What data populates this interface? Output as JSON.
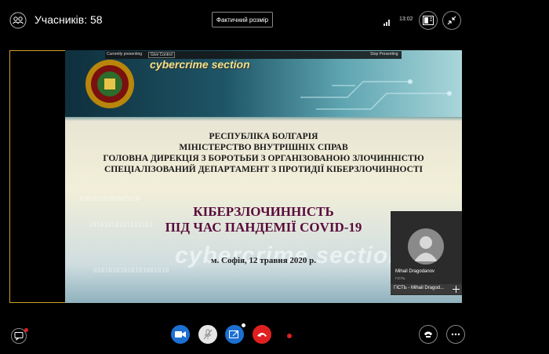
{
  "topbar": {
    "participants_label": "Учасників: 58",
    "actual_size_label": "Фактичний розмір",
    "time": "13:02"
  },
  "present_bar": {
    "currently_presenting": "Currently presenting",
    "give_control": "Give Control",
    "stop_presenting": "Stop Presenting"
  },
  "slide": {
    "logo_text": "cybercrime section",
    "watermark_text": "cybercrime section",
    "org_lines": [
      "РЕСПУБЛІКА БОЛГАРІЯ",
      "МІНІСТЕРСТВО ВНУТРІШНІХ СПРАВ",
      "ГОЛОВНА ДИРЕКЦІЯ З БОРОТЬБИ З ОРГАНІЗОВАНОЮ ЗЛОЧИННІСТЮ",
      "СПЕЦІАЛІЗОВАНИЙ ДЕПАРТАМЕНТ З ПРОТИДІЇ КІБЕРЗЛОЧИННОСТІ"
    ],
    "title_lines": [
      "КІБЕРЗЛОЧИННІСТЬ",
      "ПІД ЧАС ПАНДЕМІЇ COVID-19"
    ],
    "date_line": "м. Софія, 12 травня 2020  р.",
    "binary_lines": [
      "0101010101001010",
      "10101010101010101",
      "01010101010101001010"
    ]
  },
  "video_tile": {
    "name": "Mihail Dragodanov",
    "role": "ГІСТЬ",
    "footer_label": "ГІСТЬ - Mihail Dragod..."
  },
  "icons": {
    "participants": "people-icon",
    "layout": "layout-icon",
    "collapse": "collapse-icon",
    "chat": "chat-icon",
    "video": "camera-icon",
    "mic": "mic-muted-icon",
    "share": "share-screen-icon",
    "hangup": "hangup-icon",
    "dialpad": "phone-icon",
    "more": "more-icon"
  },
  "colors": {
    "stage_border": "#c9a227",
    "primary_blue": "#1d6fd1",
    "hangup_red": "#e02020",
    "title_color": "#5a0b3c"
  }
}
